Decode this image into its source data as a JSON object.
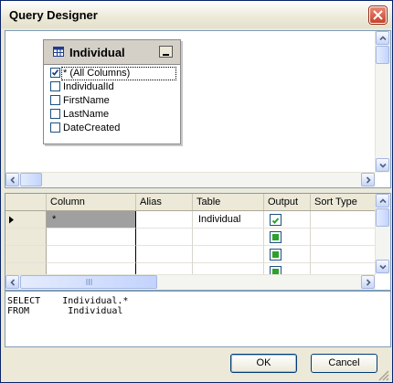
{
  "window": {
    "title": "Query Designer"
  },
  "table_box": {
    "name": "Individual",
    "columns": [
      {
        "label": "* (All Columns)",
        "checked": true
      },
      {
        "label": "IndividualId",
        "checked": false
      },
      {
        "label": "FirstName",
        "checked": false
      },
      {
        "label": "LastName",
        "checked": false
      },
      {
        "label": "DateCreated",
        "checked": false
      }
    ]
  },
  "grid": {
    "headers": [
      "Column",
      "Alias",
      "Table",
      "Output",
      "Sort Type"
    ],
    "rows": [
      {
        "column": "*",
        "alias": "",
        "table": "Individual",
        "output": "checked"
      },
      {
        "column": "",
        "alias": "",
        "table": "",
        "output": "indeterminate"
      },
      {
        "column": "",
        "alias": "",
        "table": "",
        "output": "indeterminate"
      },
      {
        "column": "",
        "alias": "",
        "table": "",
        "output": "indeterminate"
      }
    ]
  },
  "sql": {
    "line1": "SELECT    Individual.*",
    "line2": "FROM       Individual"
  },
  "buttons": {
    "ok": "OK",
    "cancel": "Cancel"
  },
  "colors": {
    "accent_check": "#2ca12c",
    "title_bar_close": "#c8412a",
    "border": "#7f9db9"
  }
}
